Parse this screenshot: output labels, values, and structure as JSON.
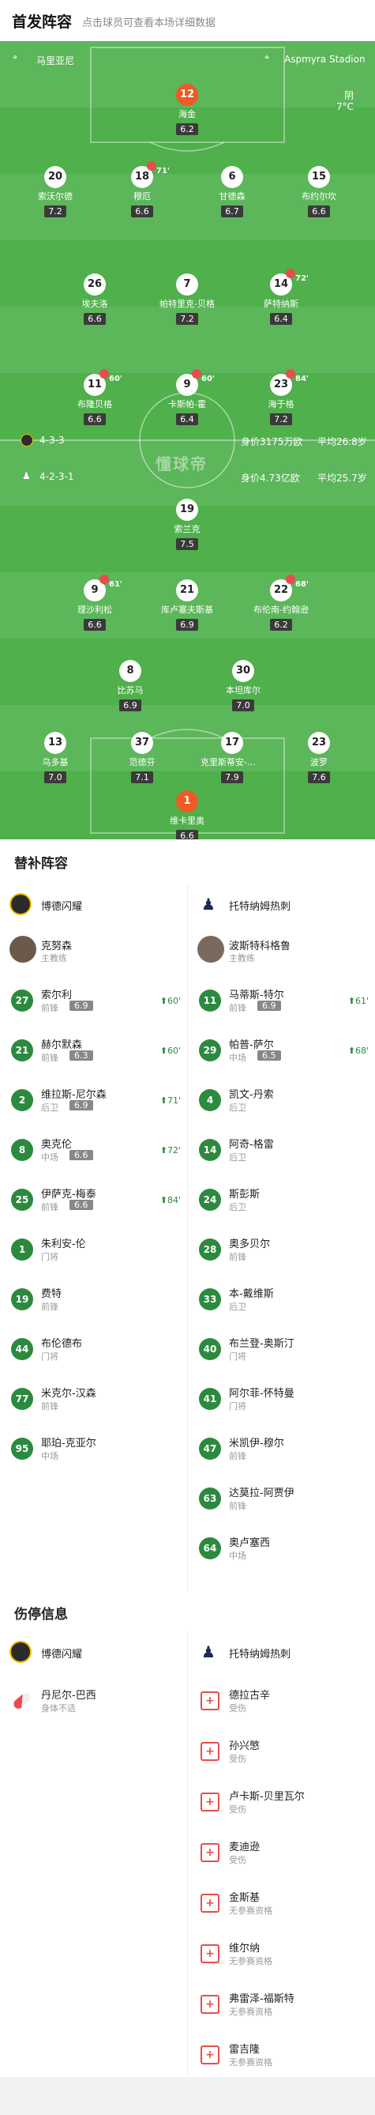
{
  "header": {
    "title": "首发阵容",
    "subtitle": "点击球员可查看本场详细数据"
  },
  "pitch": {
    "stadium_left": "马里亚尼",
    "stadium_right": "Aspmyra Stadion",
    "weather": "阴",
    "temp": "7°C",
    "watermark": "懂球帝",
    "home_formation": "4-3-3",
    "home_value": "身价3175万欧",
    "home_age": "平均26.8岁",
    "away_formation": "4-2-3-1",
    "away_value": "身价4.73亿欧",
    "away_age": "平均25.7岁"
  },
  "home_players": [
    {
      "num": "12",
      "name": "海金",
      "rating": "6.2",
      "gk": true
    },
    {
      "num": "20",
      "name": "索沃尔德",
      "rating": "7.2"
    },
    {
      "num": "18",
      "name": "穆厄",
      "rating": "6.6",
      "sub": "71'"
    },
    {
      "num": "6",
      "name": "甘德森",
      "rating": "6.7"
    },
    {
      "num": "15",
      "name": "布约尔坎",
      "rating": "6.6"
    },
    {
      "num": "26",
      "name": "埃夫洛",
      "rating": "6.6"
    },
    {
      "num": "7",
      "name": "帕特里克-贝格",
      "rating": "7.2"
    },
    {
      "num": "14",
      "name": "萨特纳斯",
      "rating": "6.4",
      "sub": "72'"
    },
    {
      "num": "11",
      "name": "布隆贝格",
      "rating": "6.6",
      "sub": "60'"
    },
    {
      "num": "9",
      "name": "卡斯帕-霍",
      "rating": "6.4",
      "sub": "60'"
    },
    {
      "num": "23",
      "name": "海于格",
      "rating": "7.2",
      "sub": "84'"
    }
  ],
  "away_players": [
    {
      "num": "19",
      "name": "索兰克",
      "rating": "7.5"
    },
    {
      "num": "9",
      "name": "理沙利松",
      "rating": "6.6",
      "sub": "61'"
    },
    {
      "num": "21",
      "name": "库卢塞夫斯基",
      "rating": "6.9"
    },
    {
      "num": "22",
      "name": "布伦南-约翰逊",
      "rating": "6.2",
      "sub": "68'"
    },
    {
      "num": "8",
      "name": "比苏马",
      "rating": "6.9"
    },
    {
      "num": "30",
      "name": "本坦库尔",
      "rating": "7.0"
    },
    {
      "num": "13",
      "name": "乌多基",
      "rating": "7.0"
    },
    {
      "num": "37",
      "name": "范德芬",
      "rating": "7.1"
    },
    {
      "num": "17",
      "name": "克里斯蒂安-罗...",
      "rating": "7.9"
    },
    {
      "num": "23",
      "name": "波罗",
      "rating": "7.6"
    },
    {
      "num": "1",
      "name": "维卡里奥",
      "rating": "6.6",
      "gk": true
    }
  ],
  "subs": {
    "title": "替补阵容",
    "home_team": "博德闪耀",
    "away_team": "托特纳姆热刺",
    "home_coach": {
      "name": "克努森",
      "role": "主教练"
    },
    "away_coach": {
      "name": "波斯特科格鲁",
      "role": "主教练"
    },
    "home": [
      {
        "num": "27",
        "name": "索尔利",
        "pos": "前锋",
        "rating": "6.9",
        "min": "60'"
      },
      {
        "num": "21",
        "name": "赫尔默森",
        "pos": "前锋",
        "rating": "6.3",
        "min": "60'"
      },
      {
        "num": "2",
        "name": "维拉斯-尼尔森",
        "pos": "后卫",
        "rating": "6.9",
        "min": "71'"
      },
      {
        "num": "8",
        "name": "奥克伦",
        "pos": "中场",
        "rating": "6.6",
        "min": "72'"
      },
      {
        "num": "25",
        "name": "伊萨克-梅泰",
        "pos": "前锋",
        "rating": "6.6",
        "min": "84'"
      },
      {
        "num": "1",
        "name": "朱利安-伦",
        "pos": "门将"
      },
      {
        "num": "19",
        "name": "费特",
        "pos": "前锋"
      },
      {
        "num": "44",
        "name": "布伦德布",
        "pos": "门将"
      },
      {
        "num": "77",
        "name": "米克尔-汉森",
        "pos": "前锋"
      },
      {
        "num": "95",
        "name": "耶珀-克亚尔",
        "pos": "中场"
      }
    ],
    "away": [
      {
        "num": "11",
        "name": "马蒂斯-特尔",
        "pos": "前锋",
        "rating": "6.9",
        "min": "61'"
      },
      {
        "num": "29",
        "name": "帕普-萨尔",
        "pos": "中场",
        "rating": "6.5",
        "min": "68'"
      },
      {
        "num": "4",
        "name": "凯文-丹索",
        "pos": "后卫"
      },
      {
        "num": "14",
        "name": "阿奇-格雷",
        "pos": "后卫"
      },
      {
        "num": "24",
        "name": "斯彭斯",
        "pos": "后卫"
      },
      {
        "num": "28",
        "name": "奥多贝尔",
        "pos": "前锋"
      },
      {
        "num": "33",
        "name": "本-戴维斯",
        "pos": "后卫"
      },
      {
        "num": "40",
        "name": "布兰登-奥斯汀",
        "pos": "门将"
      },
      {
        "num": "41",
        "name": "阿尔菲-怀特曼",
        "pos": "门将"
      },
      {
        "num": "47",
        "name": "米凯伊-穆尔",
        "pos": "前锋"
      },
      {
        "num": "63",
        "name": "达莫拉-阿贾伊",
        "pos": "前锋"
      },
      {
        "num": "64",
        "name": "奥卢塞西",
        "pos": "中场"
      }
    ]
  },
  "injuries": {
    "title": "伤停信息",
    "home": [
      {
        "name": "丹尼尔-巴西",
        "reason": "身体不适"
      }
    ],
    "away": [
      {
        "name": "德拉古辛",
        "reason": "受伤"
      },
      {
        "name": "孙兴慜",
        "reason": "受伤"
      },
      {
        "name": "卢卡斯-贝里瓦尔",
        "reason": "受伤"
      },
      {
        "name": "麦迪逊",
        "reason": "受伤"
      },
      {
        "name": "金斯基",
        "reason": "无参赛资格"
      },
      {
        "name": "维尔纳",
        "reason": "无参赛资格"
      },
      {
        "name": "弗雷泽-福斯特",
        "reason": "无参赛资格"
      },
      {
        "name": "雷吉隆",
        "reason": "无参赛资格"
      }
    ]
  }
}
